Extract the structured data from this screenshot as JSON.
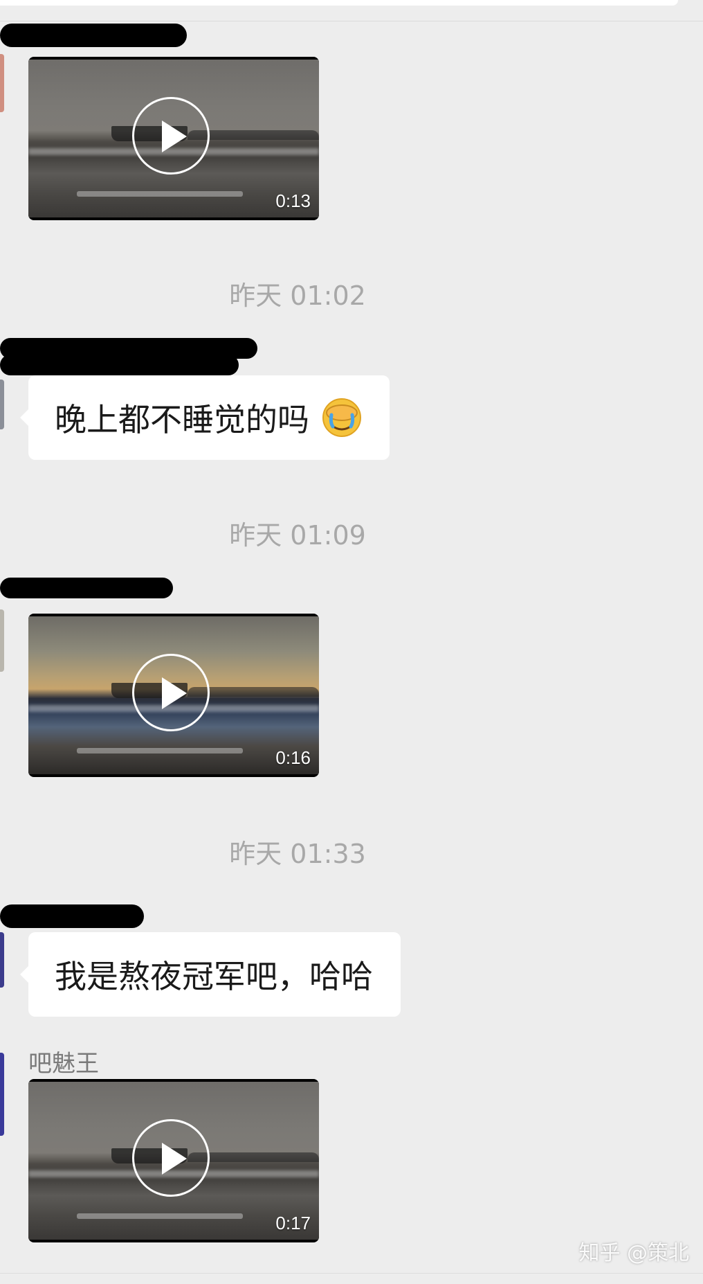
{
  "messages": [
    {
      "type": "video",
      "duration": "0:13"
    },
    {
      "type": "timestamp",
      "text": "昨天 01:02"
    },
    {
      "type": "text",
      "text": "晚上都不睡觉的吗",
      "emoji": "face-with-hand-over-eyes-crying"
    },
    {
      "type": "timestamp",
      "text": "昨天 01:09"
    },
    {
      "type": "video",
      "duration": "0:16"
    },
    {
      "type": "timestamp",
      "text": "昨天 01:33"
    },
    {
      "type": "text",
      "text": "我是熬夜冠军吧，哈哈"
    },
    {
      "type": "video",
      "sender": "吧魅王",
      "duration": "0:17"
    }
  ],
  "icons": {
    "play": "play-icon",
    "emoji": "facepalm-crying-emoji"
  },
  "watermark": "知乎 @策北",
  "colors": {
    "background": "#ededed",
    "bubble": "#ffffff",
    "timestamp": "#a8a8a8"
  }
}
